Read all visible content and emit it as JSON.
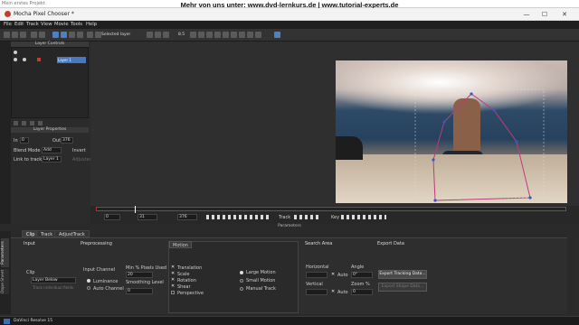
{
  "outer": {
    "title": "Mein erstes Projekt"
  },
  "banner": {
    "text": "Mehr von uns unter: www.dvd-lernkurs.de | www.tutorial-experts.de"
  },
  "app": {
    "title": "Mocha Pixel Chooser *",
    "minimize": "—",
    "maximize": "☐",
    "close": "✕"
  },
  "menu": [
    "File",
    "Edit",
    "Track",
    "View",
    "Movie",
    "Tools",
    "Help"
  ],
  "toolbar": {
    "selected_layer": "Selected layer",
    "value": "8.5"
  },
  "layer_controls": {
    "title": "Layer Controls",
    "layer_name": "Layer 1"
  },
  "layer_properties": {
    "title": "Layer Properties",
    "in_label": "In",
    "in_value": "0",
    "out_label": "Out",
    "out_value": "376",
    "blend_mode_label": "Blend Mode",
    "blend_mode_value": "Add",
    "invert_label": "Invert",
    "link_label": "Link to track",
    "link_value": "Layer 1",
    "adjusted_label": "Adjusted"
  },
  "timeline": {
    "start": "0",
    "current": "31",
    "end": "376",
    "track_label": "Track",
    "key_label": "Key"
  },
  "parameters_label": "Parameters",
  "tabs": [
    "Clip",
    "Track",
    "AdjustTrack"
  ],
  "side_tabs": [
    "Parameters",
    "Dope Sheet"
  ],
  "input": {
    "title": "Input",
    "clip_label": "Clip",
    "clip_value": "Layer Below",
    "track_individual": "Track individual fields"
  },
  "preprocessing": {
    "title": "Preprocessing",
    "input_channel_label": "Input Channel",
    "luminance": "Luminance",
    "auto_channel": "Auto Channel",
    "min_pixels_label": "Min % Pixels Used",
    "min_pixels_value": "20",
    "smoothing_label": "Smoothing Level",
    "smoothing_value": "0"
  },
  "motion": {
    "title": "Motion",
    "translation": "Translation",
    "scale": "Scale",
    "rotation": "Rotation",
    "shear": "Shear",
    "perspective": "Perspective",
    "large_motion": "Large Motion",
    "small_motion": "Small Motion",
    "manual_track": "Manual Track"
  },
  "search_area": {
    "title": "Search Area",
    "horizontal_label": "Horizontal",
    "vertical_label": "Vertical",
    "auto_label": "Auto",
    "angle_label": "Angle",
    "angle_value": "0°",
    "zoom_label": "Zoom %",
    "zoom_value": "0"
  },
  "export_data": {
    "title": "Export Data",
    "export_tracking": "Export Tracking Data...",
    "export_shape": "Export Shape Data..."
  },
  "taskbar": {
    "text": "DaVinci Resolve 15"
  },
  "colors": {
    "accent": "#4a78c0",
    "timeline_red": "#b83030"
  }
}
